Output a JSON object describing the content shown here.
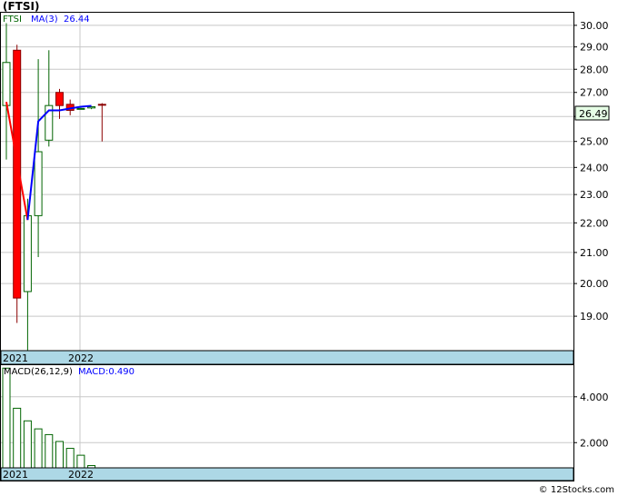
{
  "title": "(FTSI)",
  "credit": "© 12Stocks.com",
  "chart_data": [
    {
      "type": "candlestick",
      "ticker": "FTSI",
      "ma_label": "MA(3)",
      "ma_value": "26.44",
      "last_price_label": "26.49",
      "y_ticks": [
        19.0,
        20.0,
        21.0,
        22.0,
        23.0,
        24.0,
        25.0,
        26.0,
        27.0,
        28.0,
        29.0,
        30.0
      ],
      "y_tick_labels": [
        "19.00",
        "20.00",
        "21.00",
        "22.00",
        "23.00",
        "24.00",
        "25.00",
        "26.00",
        "27.00",
        "28.00",
        "29.00",
        "30.00"
      ],
      "x_labels": [
        "2021",
        "2022"
      ],
      "scale": "log",
      "candles": [
        {
          "open": 26.45,
          "high": 30.1,
          "low": 24.3,
          "close": 28.3
        },
        {
          "open": 28.85,
          "high": 29.1,
          "low": 18.8,
          "close": 19.55
        },
        {
          "open": 19.75,
          "high": 22.85,
          "low": 17.95,
          "close": 22.25
        },
        {
          "open": 22.25,
          "high": 28.45,
          "low": 20.85,
          "close": 24.6
        },
        {
          "open": 25.05,
          "high": 28.85,
          "low": 24.8,
          "close": 26.45
        },
        {
          "open": 27.0,
          "high": 27.15,
          "low": 25.9,
          "close": 26.45
        },
        {
          "open": 26.5,
          "high": 26.7,
          "low": 26.05,
          "close": 26.25
        },
        {
          "open": 26.3,
          "high": 26.35,
          "low": 26.3,
          "close": 26.33
        },
        {
          "open": 26.35,
          "high": 26.4,
          "low": 26.3,
          "close": 26.4
        },
        {
          "open": 26.5,
          "high": 26.55,
          "low": 25.0,
          "close": 26.49
        }
      ],
      "ma3": [
        26.6,
        null,
        22.1,
        25.8,
        26.25,
        26.25,
        26.33,
        26.4,
        26.44
      ],
      "ma3_start_index": 0
    },
    {
      "type": "bar",
      "label": "MACD(26,12,9)",
      "value_label": "MACD:0.490",
      "y_ticks": [
        2.0,
        4.0
      ],
      "y_tick_labels": [
        "2.000",
        "4.000"
      ],
      "x_labels": [
        "2021",
        "2022"
      ],
      "values": [
        5.25,
        3.5,
        2.95,
        2.6,
        2.35,
        2.05,
        1.75,
        1.45,
        1.0
      ]
    }
  ],
  "colors": {
    "up_body": "#ffffff",
    "up_border": "#006400",
    "down_body": "#ff0000",
    "down_border": "#8b0000",
    "ma_line": "#0000ff",
    "ma_early": "#ff0000",
    "axis_band": "#add8e6",
    "grid": "#c8c8c8",
    "price_label_bg": "#e6ffe6",
    "macd_bar": "#006400"
  }
}
